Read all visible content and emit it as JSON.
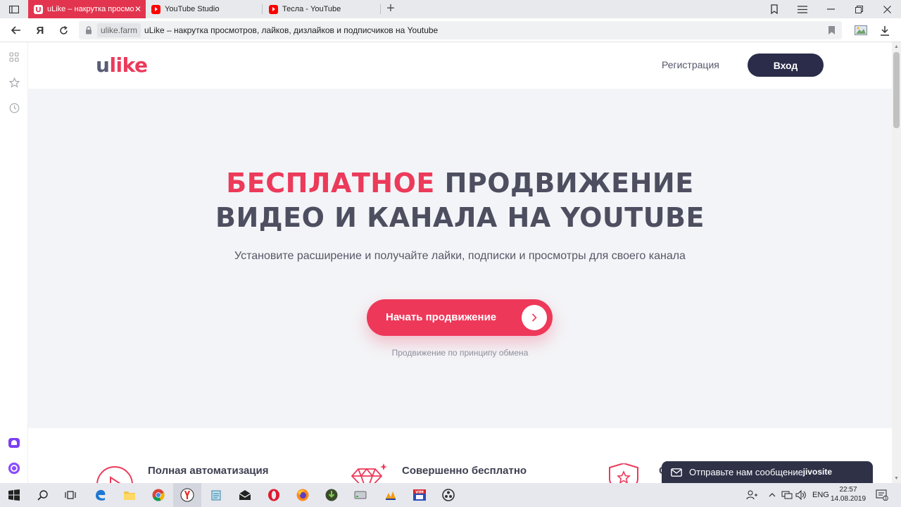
{
  "browser": {
    "tabs": [
      {
        "title": "uLike – накрутка просмо",
        "active": true
      },
      {
        "title": "YouTube Studio",
        "active": false
      },
      {
        "title": "Тесла - YouTube",
        "active": false
      }
    ],
    "address": {
      "domain": "ulike.farm",
      "page_title": "uLike – накрутка просмотров, лайков, дизлайков и подписчиков на Youtube"
    },
    "yandex_letter": "Я"
  },
  "site": {
    "logo_u": "u",
    "logo_like": "like",
    "register_label": "Регистрация",
    "login_label": "Вход",
    "hero": {
      "title_accent": "БЕСПЛАТНОЕ",
      "title_line1_rest": " ПРОДВИЖЕНИЕ",
      "title_line2": "ВИДЕО И КАНАЛА НА YOUTUBE",
      "subtitle": "Установите расширение и получайте лайки, подписки и просмотры для своего канала",
      "cta_label": "Начать продвижение",
      "cta_note": "Продвижение по принципу обмена"
    },
    "features": [
      {
        "title": "Полная автоматизация",
        "icon": "play-circle-icon"
      },
      {
        "title": "Совершенно бесплатно",
        "icon": "diamond-icon"
      },
      {
        "title": "С",
        "icon": "shield-star-icon"
      }
    ],
    "chat": {
      "label": "Отправьте нам сообщение",
      "brand": "jivosite"
    }
  },
  "taskbar": {
    "language": "ENG",
    "time": "22:57",
    "date": "14.08.2019",
    "notifications": "3"
  },
  "colors": {
    "accent": "#ec3a5a",
    "dark": "#2a2c49",
    "tab_active": "#e2344e"
  }
}
